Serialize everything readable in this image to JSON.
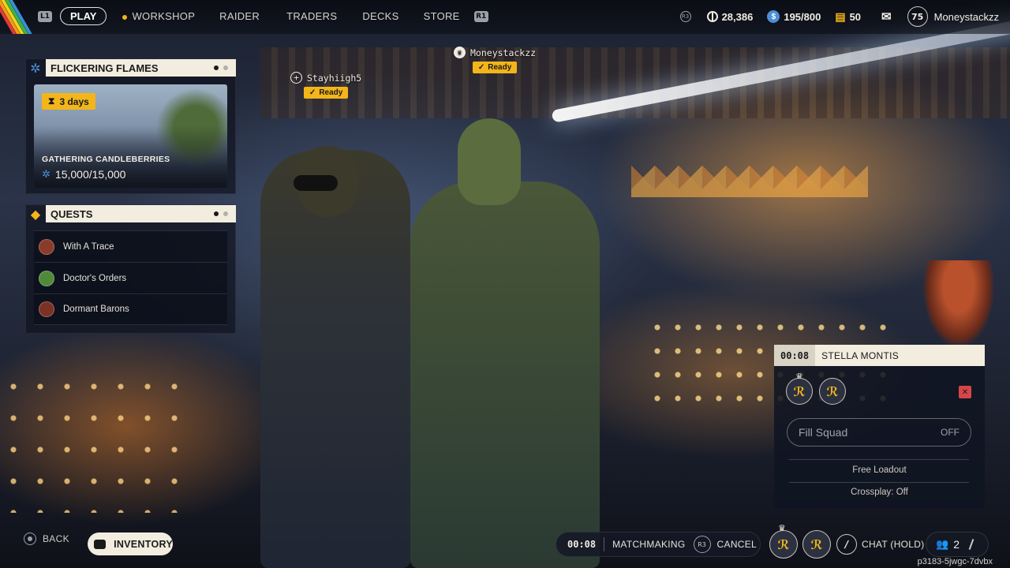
{
  "colors": {
    "accent": "#f3b51a",
    "panel_header": "#f3ede0",
    "panel_bg": "#101420",
    "mic_muted": "#d54646",
    "seed_blue": "#4d8fd6"
  },
  "topbar": {
    "left_bumper": "L1",
    "right_bumper": "R1",
    "nav": [
      {
        "label": "PLAY",
        "active": true
      },
      {
        "label": "WORKSHOP",
        "icon": "workshop-dot-icon"
      },
      {
        "label": "RAIDER"
      },
      {
        "label": "TRADERS"
      },
      {
        "label": "DECKS"
      },
      {
        "label": "STORE"
      }
    ],
    "stats_hint": "R3",
    "coins": "28,386",
    "seeds": "195/800",
    "tickets": "50",
    "player_level": "75",
    "player_name": "Moneystackzz"
  },
  "event": {
    "title": "FLICKERING FLAMES",
    "time_left": "3 days",
    "task": "GATHERING CANDLEBERRIES",
    "progress": "15,000/15,000",
    "pager_pages": 2,
    "pager_active": 1
  },
  "quests": {
    "title": "QUESTS",
    "items": [
      {
        "label": "With A Trace",
        "avatar_color": "#8a3b2a"
      },
      {
        "label": "Doctor's Orders",
        "avatar_color": "#4f8a3a"
      },
      {
        "label": "Dormant Barons",
        "avatar_color": "#7a3225"
      }
    ]
  },
  "players": [
    {
      "name": "Stayhiigh5",
      "status": "Ready",
      "icon": "plus-circle-icon"
    },
    {
      "name": "Moneystackzz",
      "status": "Ready",
      "icon": "crown-icon"
    }
  ],
  "squad": {
    "timer": "00:08",
    "location": "STELLA MONTIS",
    "fill_label": "Fill Squad",
    "fill_state": "OFF",
    "loadout": "Free Loadout",
    "crossplay": "Crossplay: Off"
  },
  "bottom": {
    "back_label": "BACK",
    "inventory_label": "INVENTORY",
    "mm_time": "00:08",
    "mm_label": "MATCHMAKING",
    "cancel_hint": "R3",
    "cancel_label": "CANCEL",
    "chat_label": "CHAT (HOLD)",
    "party_count": "2",
    "build_id": "p3183-5jwgc-7dvbx"
  }
}
